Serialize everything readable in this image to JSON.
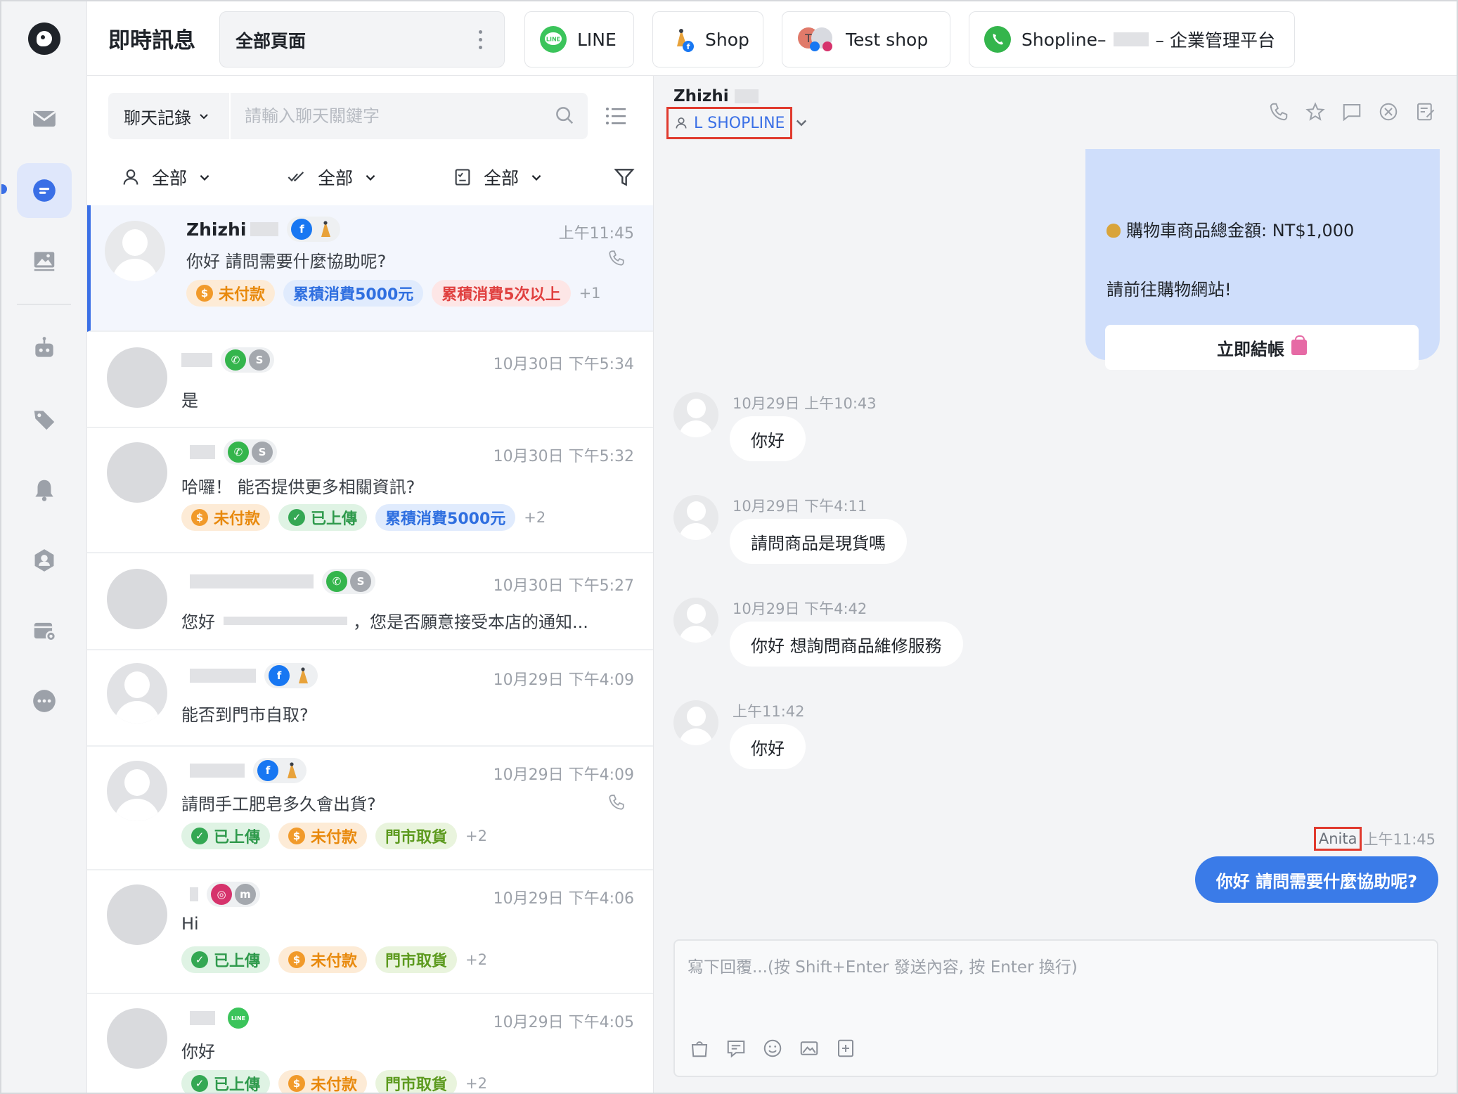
{
  "app": {
    "title": "即時訊息"
  },
  "top": {
    "page_select": "全部頁面",
    "channels": [
      {
        "label": "LINE",
        "icon": "line-icon"
      },
      {
        "label": "Shop",
        "icon": "shop-facebook-icon"
      },
      {
        "label": "Test shop",
        "icon": "test-shop-icon"
      },
      {
        "label_prefix": "Shopline–",
        "label_suffix": "– 企業管理平台",
        "icon": "whatsapp-icon"
      }
    ]
  },
  "rail": {
    "items": [
      "inbox-icon",
      "chat-icon",
      "gallery-icon",
      "bot-icon",
      "tags-icon",
      "bell-icon",
      "contacts-icon",
      "calendar-settings-icon",
      "more-icon"
    ]
  },
  "search": {
    "type": "聊天記錄",
    "placeholder": "請輸入聊天關鍵字"
  },
  "filters": {
    "assignee": "全部",
    "read_state": "全部",
    "task": "全部"
  },
  "conversations": [
    {
      "name": "Zhizhi",
      "time": "上午11:45",
      "message": "你好 請問需要什麼協助呢?",
      "badges": [
        {
          "type": "unpaid",
          "label": "未付款"
        },
        {
          "type": "spent",
          "label": "累積消費5000元"
        },
        {
          "type": "count",
          "label": "累積消費5次以上"
        }
      ],
      "more": "+1"
    },
    {
      "name": "",
      "time": "10月30日 下午5:34",
      "message": "是",
      "badges": [],
      "more": ""
    },
    {
      "name": "",
      "time": "10月30日 下午5:32",
      "message": "哈囉！ 能否提供更多相關資訊?",
      "badges": [
        {
          "type": "unpaid",
          "label": "未付款"
        },
        {
          "type": "uploaded",
          "label": "已上傳"
        },
        {
          "type": "spent",
          "label": "累積消費5000元"
        }
      ],
      "more": "+2"
    },
    {
      "name": "",
      "time": "10月30日 下午5:27",
      "message_prefix": "您好",
      "message_suffix": "，您是否願意接受本店的通知...",
      "badges": [],
      "more": ""
    },
    {
      "name": "",
      "time": "10月29日 下午4:09",
      "message": "能否到門市自取?",
      "badges": [],
      "more": ""
    },
    {
      "name": "",
      "time": "10月29日 下午4:09",
      "message": "請問手工肥皂多久會出貨?",
      "badges": [
        {
          "type": "uploaded",
          "label": "已上傳"
        },
        {
          "type": "unpaid",
          "label": "未付款"
        },
        {
          "type": "pickup",
          "label": "門市取貨"
        }
      ],
      "more": "+2"
    },
    {
      "name": "",
      "time": "10月29日 下午4:06",
      "message": "Hi",
      "badges": [
        {
          "type": "uploaded",
          "label": "已上傳"
        },
        {
          "type": "unpaid",
          "label": "未付款"
        },
        {
          "type": "pickup",
          "label": "門市取貨"
        }
      ],
      "more": "+2"
    },
    {
      "name": "",
      "time": "10月29日 下午4:05",
      "message": "你好",
      "badges": [
        {
          "type": "uploaded",
          "label": "已上傳"
        },
        {
          "type": "unpaid",
          "label": "未付款"
        },
        {
          "type": "pickup",
          "label": "門市取貨"
        }
      ],
      "more": "+2"
    }
  ],
  "chat": {
    "contact_name": "Zhizhi",
    "store": "L SHOPLINE",
    "card": {
      "total_line": "購物車商品總金額: NT$1,000",
      "prompt_line": "請前往購物網站!",
      "button": "立即結帳"
    },
    "messages": [
      {
        "time": "10月29日 上午10:43",
        "text": "你好"
      },
      {
        "time": "10月29日 下午4:11",
        "text": "請問商品是現貨嗎"
      },
      {
        "time": "10月29日 下午4:42",
        "text": "你好 想詢問商品維修服務"
      },
      {
        "time": "上午11:42",
        "text": "你好"
      }
    ],
    "outgoing": {
      "agent": "Anita",
      "time": "上午11:45",
      "text": "你好 請問需要什麼協助呢?"
    },
    "composer_placeholder": "寫下回覆...(按 Shift+Enter 發送內容, 按 Enter 換行)"
  },
  "colors": {
    "accent": "#3a6fe6",
    "outgoing_bubble": "#3a7be8",
    "card": "#cfdefb",
    "highlight_box": "#e03a2e"
  }
}
